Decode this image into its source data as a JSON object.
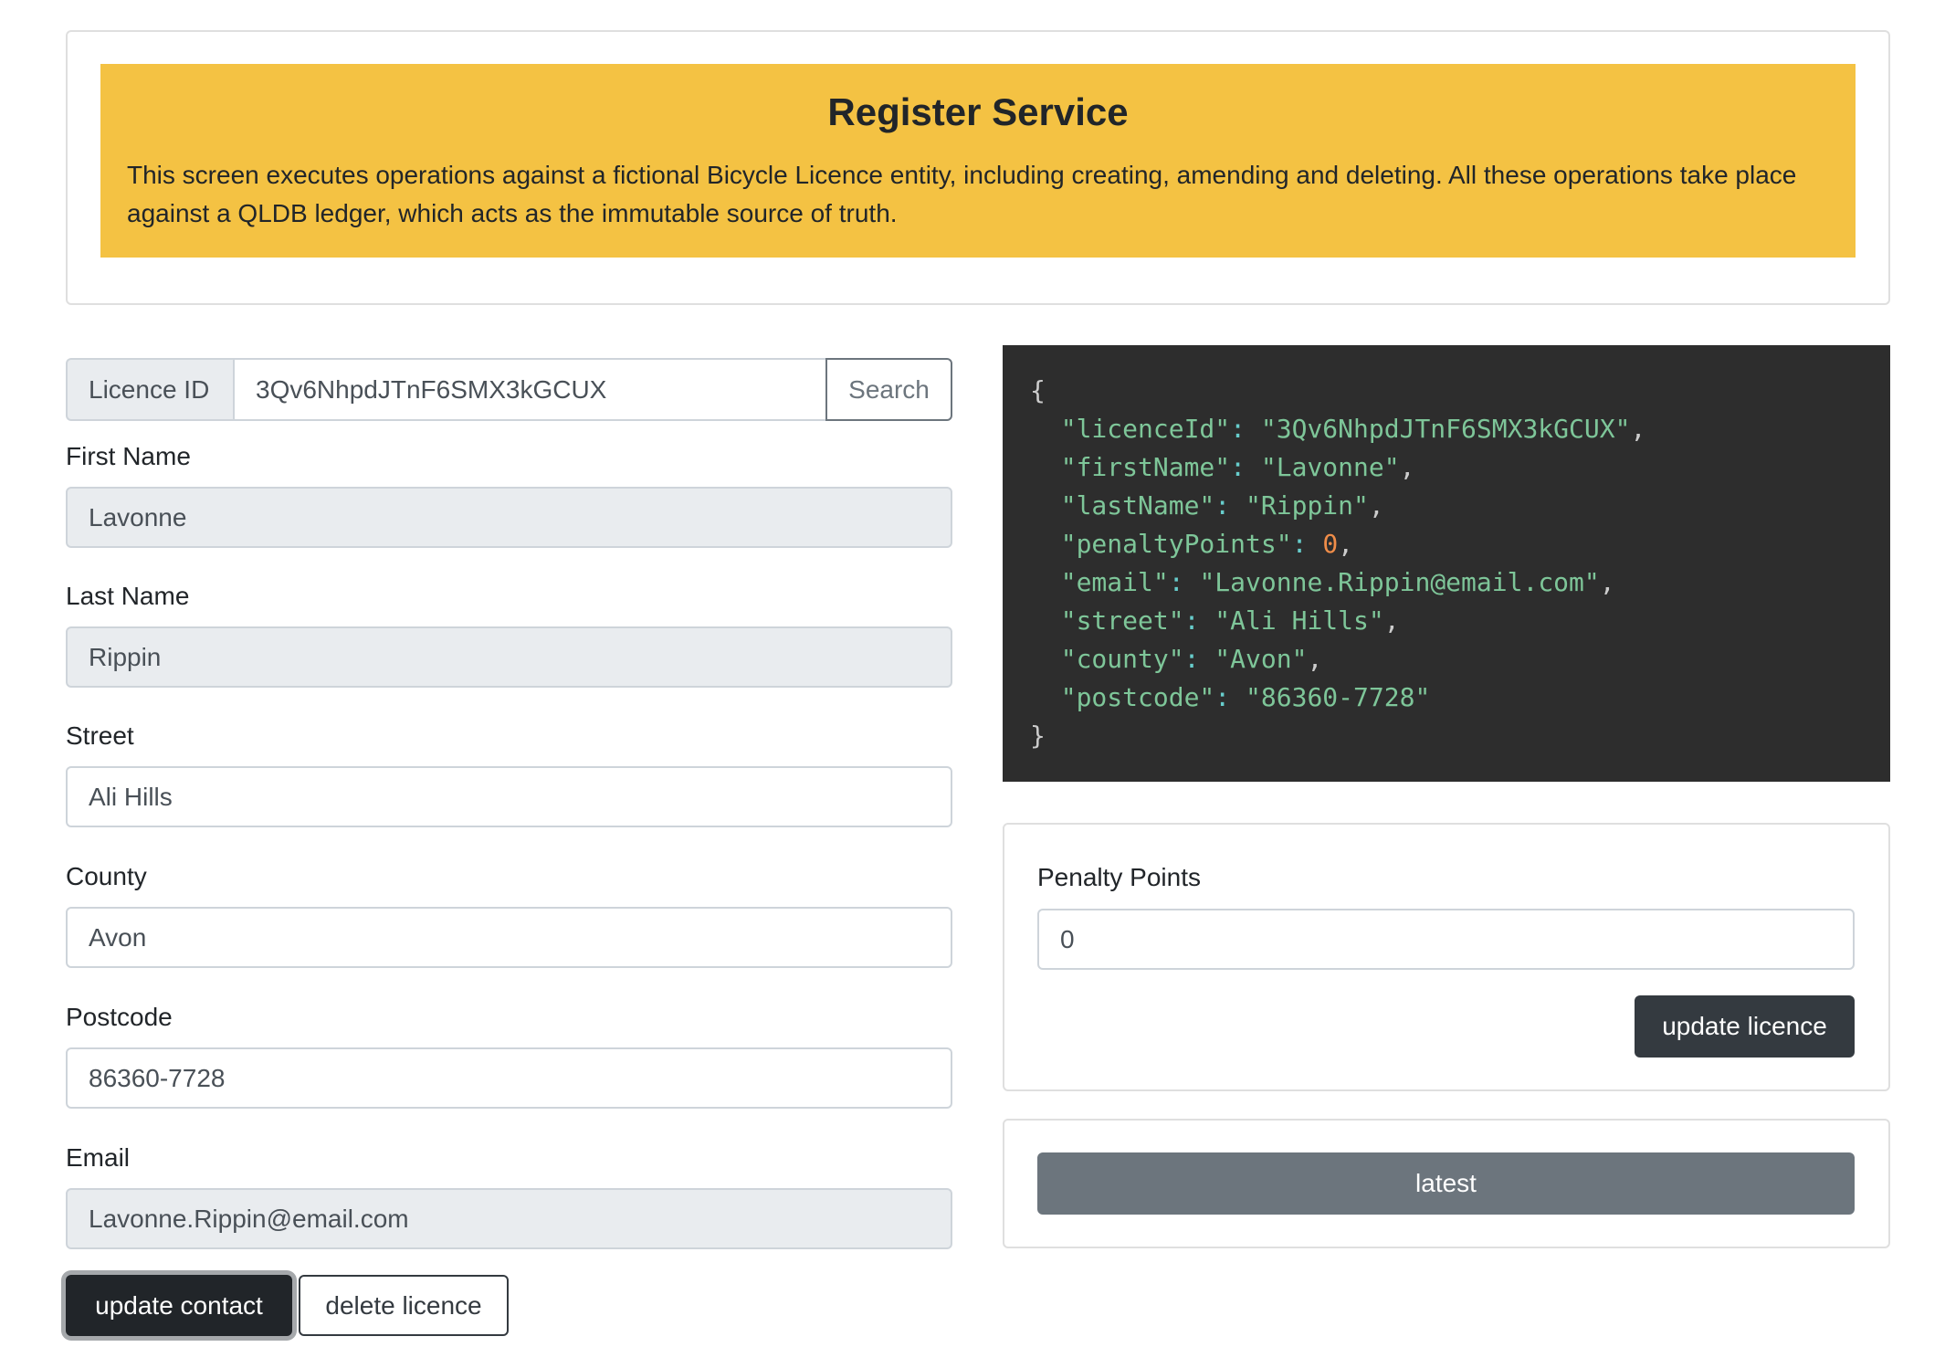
{
  "header": {
    "title": "Register Service",
    "description": "This screen executes operations against a fictional Bicycle Licence entity, including creating, amending and deleting. All these operations take place against a QLDB ledger, which acts as the immutable source of truth.",
    "banner_color": "#f4c243"
  },
  "search": {
    "addon_label": "Licence ID",
    "value": "3Qv6NhpdJTnF6SMX3kGCUX",
    "button_label": "Search"
  },
  "form": {
    "fields": [
      {
        "label": "First Name",
        "value": "Lavonne",
        "readonly": true
      },
      {
        "label": "Last Name",
        "value": "Rippin",
        "readonly": true
      },
      {
        "label": "Street",
        "value": "Ali Hills",
        "readonly": false
      },
      {
        "label": "County",
        "value": "Avon",
        "readonly": false
      },
      {
        "label": "Postcode",
        "value": "86360-7728",
        "readonly": false
      },
      {
        "label": "Email",
        "value": "Lavonne.Rippin@email.com",
        "readonly": true
      }
    ],
    "update_contact_label": "update contact",
    "delete_licence_label": "delete licence"
  },
  "json_view": {
    "open_brace": "{",
    "close_brace": "}",
    "entries": [
      {
        "key": "\"licenceId\"",
        "value": "\"3Qv6NhpdJTnF6SMX3kGCUX\"",
        "type": "string",
        "comma": ","
      },
      {
        "key": "\"firstName\"",
        "value": "\"Lavonne\"",
        "type": "string",
        "comma": ","
      },
      {
        "key": "\"lastName\"",
        "value": "\"Rippin\"",
        "type": "string",
        "comma": ","
      },
      {
        "key": "\"penaltyPoints\"",
        "value": "0",
        "type": "number",
        "comma": ","
      },
      {
        "key": "\"email\"",
        "value": "\"Lavonne.Rippin@email.com\"",
        "type": "string",
        "comma": ","
      },
      {
        "key": "\"street\"",
        "value": "\"Ali Hills\"",
        "type": "string",
        "comma": ","
      },
      {
        "key": "\"county\"",
        "value": "\"Avon\"",
        "type": "string",
        "comma": ","
      },
      {
        "key": "\"postcode\"",
        "value": "\"86360-7728\"",
        "type": "string",
        "comma": ""
      }
    ],
    "colon": ":"
  },
  "penalty": {
    "label": "Penalty Points",
    "value": "0",
    "update_licence_label": "update licence"
  },
  "latest": {
    "button_label": "latest"
  }
}
